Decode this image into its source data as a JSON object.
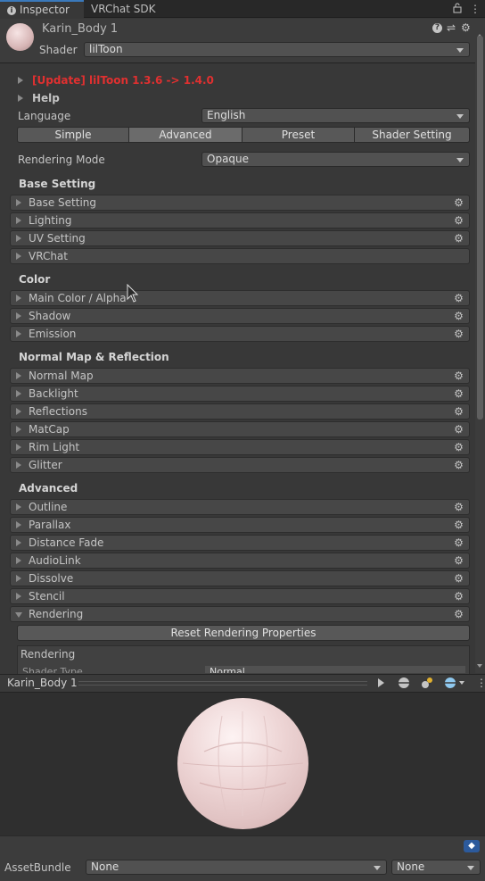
{
  "tabs": [
    {
      "label": "Inspector"
    },
    {
      "label": "VRChat SDK"
    }
  ],
  "header": {
    "material_name": "Karin_Body 1",
    "shader_label": "Shader",
    "shader_value": "lilToon"
  },
  "items": {
    "update": "[Update] lilToon 1.3.6 -> 1.4.0",
    "help": "Help"
  },
  "language": {
    "label": "Language",
    "value": "English"
  },
  "modes": [
    "Simple",
    "Advanced",
    "Preset",
    "Shader Setting"
  ],
  "rendering_mode": {
    "label": "Rendering Mode",
    "value": "Opaque"
  },
  "sections": {
    "base": {
      "title": "Base Setting",
      "items": [
        "Base Setting",
        "Lighting",
        "UV Setting",
        "VRChat"
      ]
    },
    "color": {
      "title": "Color",
      "items": [
        "Main Color / Alpha",
        "Shadow",
        "Emission"
      ]
    },
    "normal": {
      "title": "Normal Map & Reflection",
      "items": [
        "Normal Map",
        "Backlight",
        "Reflections",
        "MatCap",
        "Rim Light",
        "Glitter"
      ]
    },
    "advanced": {
      "title": "Advanced",
      "items": [
        "Outline",
        "Parallax",
        "Distance Fade",
        "AudioLink",
        "Dissolve",
        "Stencil",
        "Rendering"
      ]
    }
  },
  "rendering": {
    "reset_label": "Reset Rendering Properties",
    "box_title": "Rendering",
    "shader_type_label": "Shader Type",
    "shader_type_value": "Normal"
  },
  "preview": {
    "title": "Karin_Body 1"
  },
  "asset_bundle": {
    "label": "AssetBundle",
    "name_value": "None",
    "variant_value": "None"
  },
  "icons": [
    "info-icon",
    "lock-icon",
    "more-icon",
    "help-icon",
    "preset-icon",
    "gear-icon",
    "play-icon",
    "sphere-icon",
    "light-icon",
    "tag-icon"
  ],
  "colors": {
    "update_text": "#e03030",
    "accent_tab": "#3a79bb",
    "tag": "#2c5a9c"
  }
}
